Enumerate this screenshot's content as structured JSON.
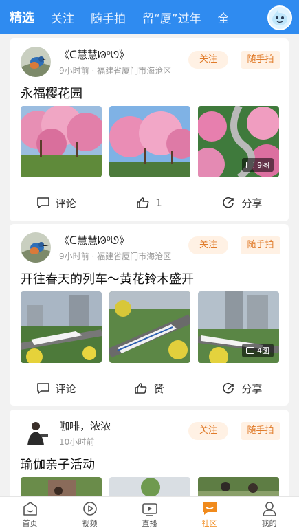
{
  "tabs": [
    {
      "label": "精选",
      "active": true
    },
    {
      "label": "关注"
    },
    {
      "label": "随手拍"
    },
    {
      "label": "留“厦”过年"
    },
    {
      "label": "全"
    }
  ],
  "posts": [
    {
      "author": "《ᑕ慧慧ᘙ⁰ᘎ》",
      "time": "9小时前",
      "location": "· 福建省厦门市海沧区",
      "follow_label": "关注",
      "tag": "随手拍",
      "title": "永福樱花园",
      "image_count": "9图",
      "comment_label": "评论",
      "like_label": "1",
      "share_label": "分享"
    },
    {
      "author": "《ᑕ慧慧ᘙ⁰ᘎ》",
      "time": "9小时前",
      "location": "· 福建省厦门市海沧区",
      "follow_label": "关注",
      "tag": "随手拍",
      "title": "开往春天的列车～黄花铃木盛开",
      "image_count": "4图",
      "comment_label": "评论",
      "like_label": "赞",
      "share_label": "分享"
    },
    {
      "author": "咖啡，浓浓",
      "time": "10小时前",
      "follow_label": "关注",
      "tag": "随手拍",
      "title": "瑜伽亲子活动"
    }
  ],
  "bottom_nav": [
    {
      "label": "首页",
      "icon": "home-icon"
    },
    {
      "label": "视频",
      "icon": "play-icon"
    },
    {
      "label": "直播",
      "icon": "tv-icon"
    },
    {
      "label": "社区",
      "icon": "community-icon",
      "active": true
    },
    {
      "label": "我的",
      "icon": "person-icon"
    }
  ],
  "colors": {
    "brand_blue": "#2f8bf0",
    "accent_orange": "#f08a1c",
    "tag_bg": "#fff1e4"
  }
}
